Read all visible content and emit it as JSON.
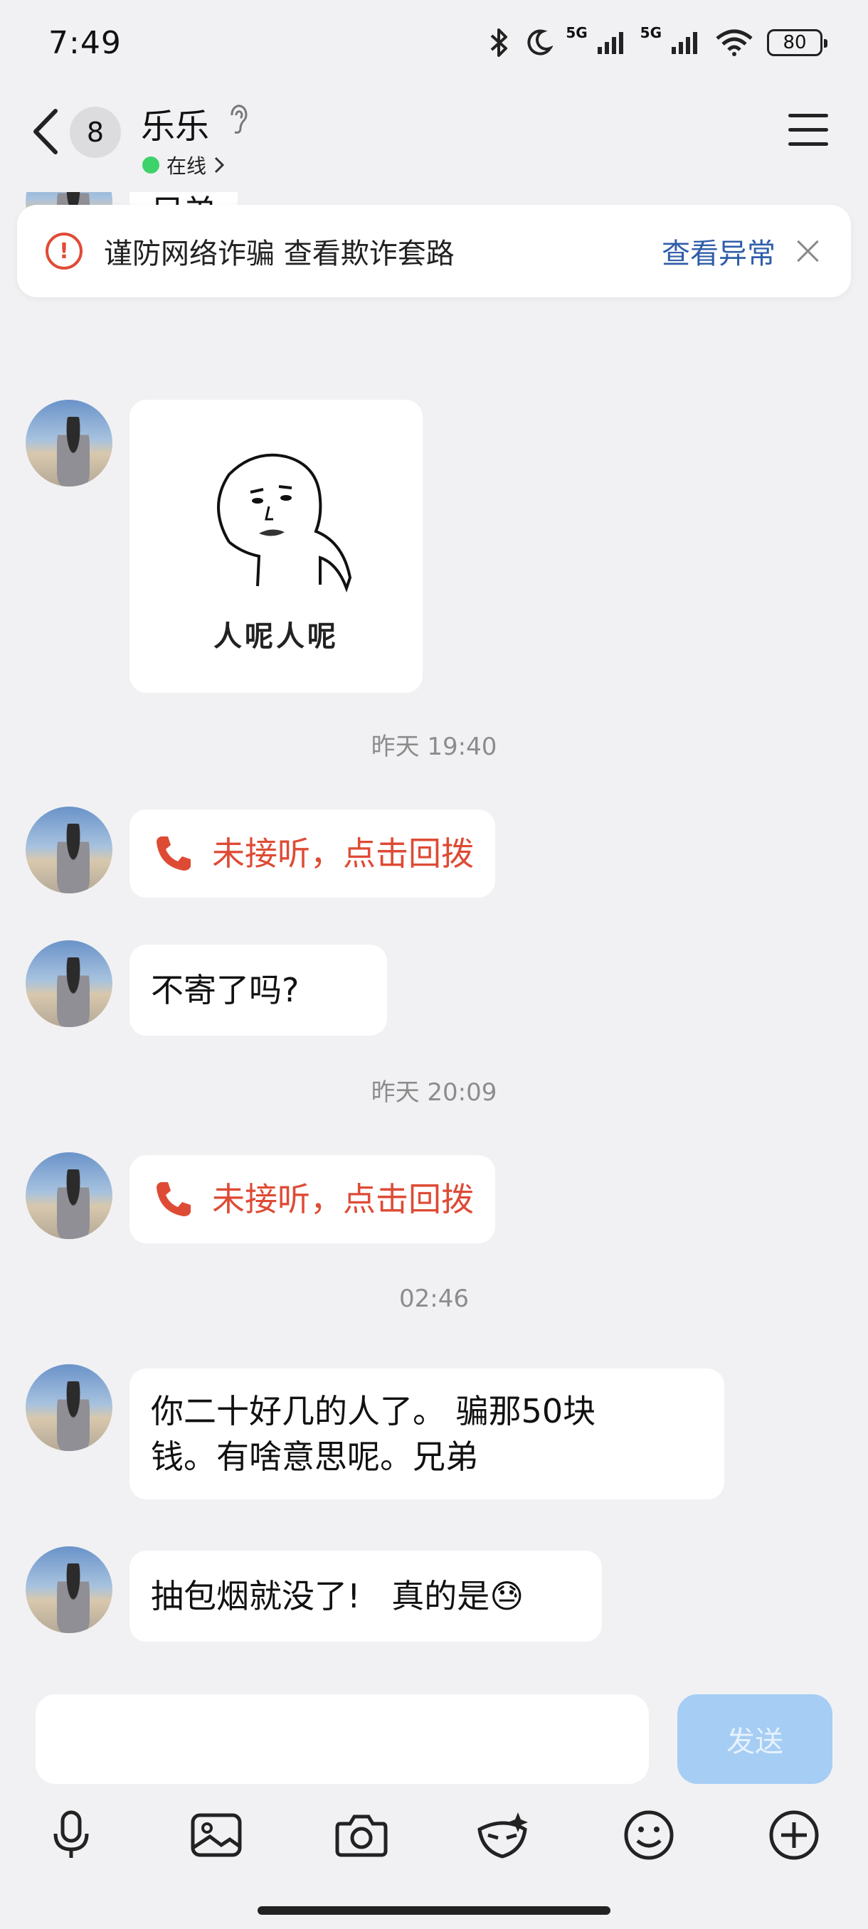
{
  "status_bar": {
    "time": "7:49",
    "signal1": "5G",
    "signal2": "5G",
    "battery": "80"
  },
  "header": {
    "unread_count": "8",
    "contact_name": "乐乐",
    "online_status": "在线"
  },
  "warning": {
    "text": "谨防网络诈骗 查看欺诈套路",
    "link": "查看异常"
  },
  "messages": {
    "m1": "兄弟",
    "sticker_caption": "人呢人呢",
    "ts1": "昨天 19:40",
    "call1": "未接听，点击回拨",
    "m2": "不寄了吗?",
    "ts2": "昨天 20:09",
    "call2": "未接听，点击回拨",
    "ts3": "02:46",
    "m3_line1": "你二十好几的人了。 骗那50块",
    "m3_line2": "钱。有啥意思呢。兄弟",
    "m4": "抽包烟就没了!   真的是😓"
  },
  "input": {
    "value": "",
    "send_label": "发送"
  },
  "toolbar": {
    "icons": [
      "microphone-icon",
      "image-icon",
      "camera-icon",
      "filter-icon",
      "emoji-icon",
      "plus-icon"
    ]
  },
  "colors": {
    "accent_red": "#de4b35",
    "link_blue": "#2f5ea8",
    "send_disabled": "#a6cdf4",
    "online": "#3ed36a"
  }
}
